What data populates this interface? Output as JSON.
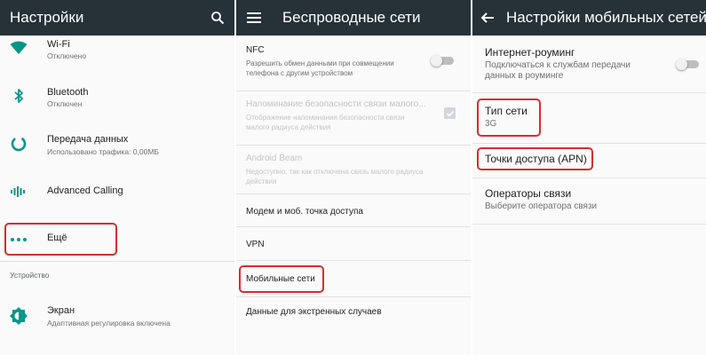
{
  "colors": {
    "appbar": "#263238",
    "accent": "#009688",
    "highlight": "#d32f2f"
  },
  "settings": {
    "title": "Настройки",
    "search_icon": "search-icon",
    "items": [
      {
        "icon": "wifi-icon",
        "title": "Wi-Fi",
        "subtitle": "Отключено"
      },
      {
        "icon": "bluetooth-icon",
        "title": "Bluetooth",
        "subtitle": "Отключен"
      },
      {
        "icon": "data-usage-icon",
        "title": "Передача данных",
        "subtitle": "Использовано трафика: 0,00МБ"
      },
      {
        "icon": "advanced-calling-icon",
        "title": "Advanced Calling"
      },
      {
        "icon": "more-dots-icon",
        "title": "Ещё"
      }
    ],
    "section_device": "Устройство",
    "display": {
      "icon": "brightness-icon",
      "title": "Экран",
      "subtitle": "Адаптивная регулировка включена"
    }
  },
  "wireless": {
    "title": "Беспроводные сети",
    "menu_icon": "menu-icon",
    "nfc": {
      "title": "NFC",
      "subtitle": "Разрешить обмен данными при совмещении телефона с другим устройством",
      "enabled": false
    },
    "security_reminder": {
      "title": "Напоминание безопасности связи малого...",
      "subtitle": "Отображение напоминания безопасности связи малого радиуса действия",
      "checked": true
    },
    "android_beam": {
      "title": "Android Beam",
      "subtitle": "Недоступно, так как отключена связь малого радиуса действия"
    },
    "items": [
      "Модем и моб. точка доступа",
      "VPN",
      "Мобильные сети",
      "Данные для экстренных случаев"
    ]
  },
  "mobile": {
    "title": "Настройки мобильных сетей",
    "back_icon": "arrow-back-icon",
    "roaming": {
      "title": "Интернет-роуминг",
      "subtitle": "Подключаться к службам передачи данных в роуминге",
      "enabled": false
    },
    "network_type": {
      "title": "Тип сети",
      "value": "3G"
    },
    "apn": {
      "title": "Точки доступа (APN)"
    },
    "operators": {
      "title": "Операторы связи",
      "subtitle": "Выберите оператора связи"
    }
  }
}
